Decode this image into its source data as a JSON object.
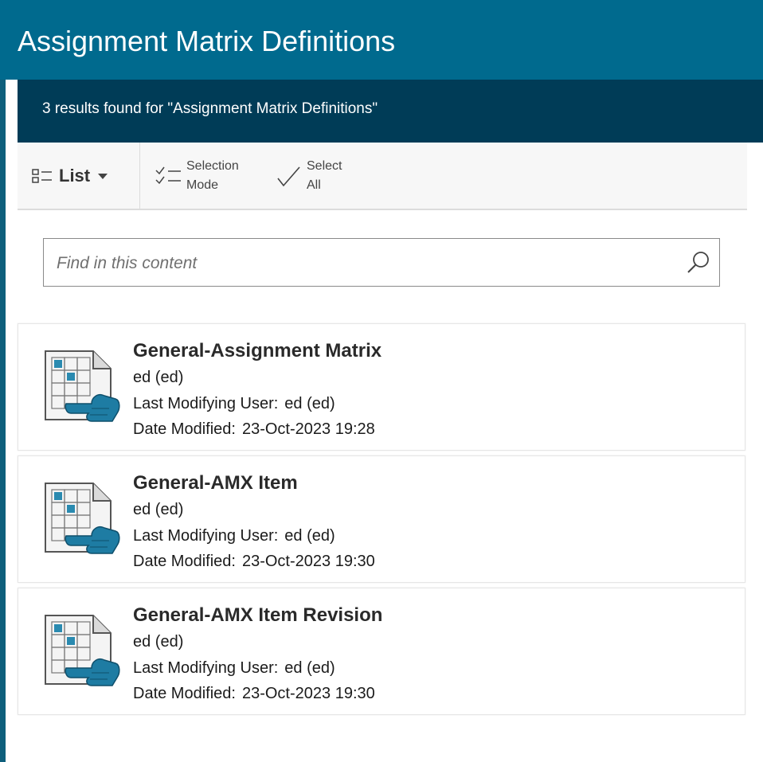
{
  "header": {
    "title": "Assignment Matrix Definitions"
  },
  "results_bar": {
    "text": "3 results found for \"Assignment Matrix Definitions\""
  },
  "toolbar": {
    "list_label": "List",
    "selection_mode_line1": "Selection",
    "selection_mode_line2": "Mode",
    "select_all_line1": "Select",
    "select_all_line2": "All"
  },
  "search": {
    "placeholder": "Find in this content",
    "value": ""
  },
  "results": [
    {
      "title": "General-Assignment Matrix",
      "owner": "ed (ed)",
      "last_modifying_user_label": "Last Modifying User:",
      "last_modifying_user": "ed (ed)",
      "date_modified_label": "Date Modified:",
      "date_modified": "23-Oct-2023 19:28"
    },
    {
      "title": "General-AMX Item",
      "owner": "ed (ed)",
      "last_modifying_user_label": "Last Modifying User:",
      "last_modifying_user": "ed (ed)",
      "date_modified_label": "Date Modified:",
      "date_modified": "23-Oct-2023 19:30"
    },
    {
      "title": "General-AMX Item Revision",
      "owner": "ed (ed)",
      "last_modifying_user_label": "Last Modifying User:",
      "last_modifying_user": "ed (ed)",
      "date_modified_label": "Date Modified:",
      "date_modified": "23-Oct-2023 19:30"
    }
  ],
  "icons": {
    "list_view": "list-view-icon",
    "selection_mode": "selection-mode-icon",
    "select_all": "checkmark-icon",
    "search": "search-icon",
    "result_item": "assignment-matrix-icon"
  },
  "colors": {
    "header": "#006a8e",
    "results_bar": "#003c57",
    "accent": "#2a8ab0"
  }
}
